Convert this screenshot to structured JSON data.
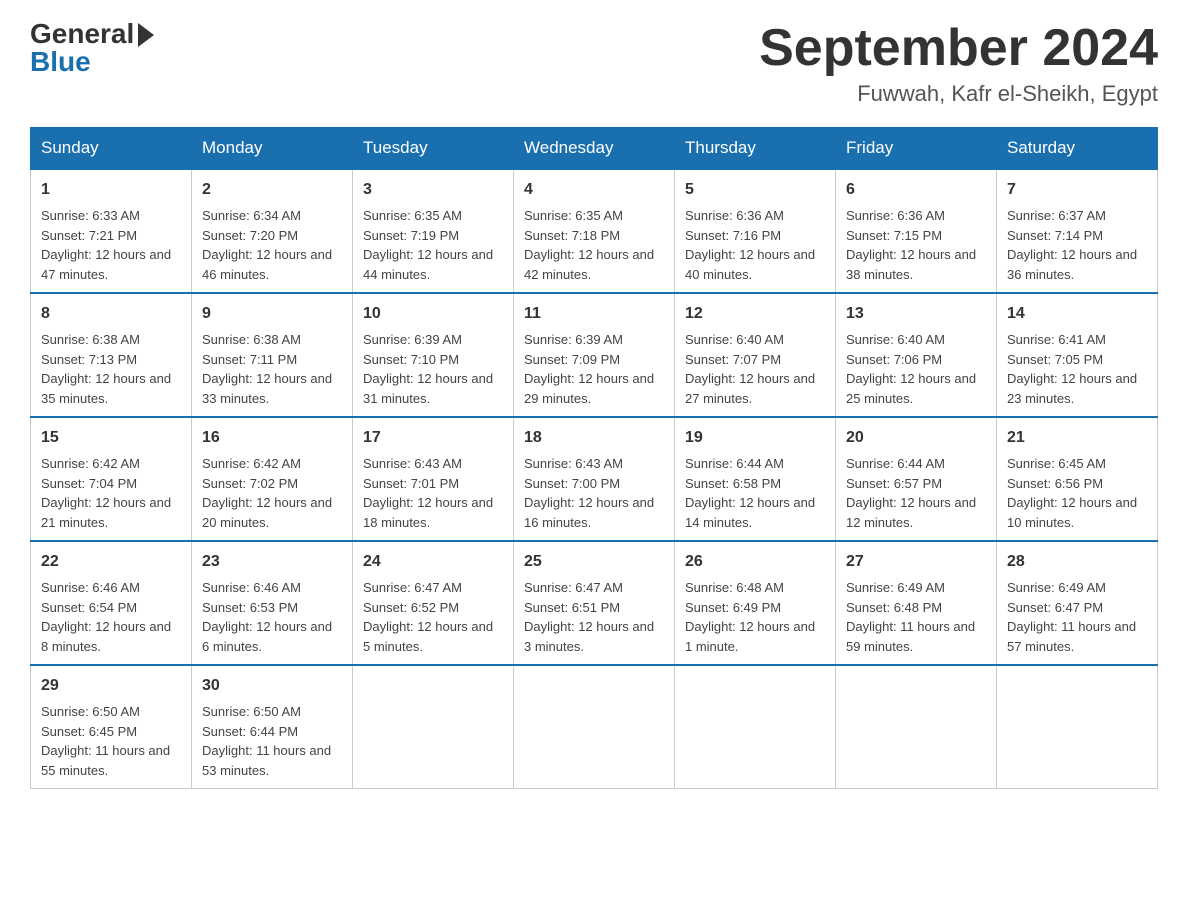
{
  "logo": {
    "general": "General",
    "blue": "Blue"
  },
  "title": "September 2024",
  "location": "Fuwwah, Kafr el-Sheikh, Egypt",
  "weekdays": [
    "Sunday",
    "Monday",
    "Tuesday",
    "Wednesday",
    "Thursday",
    "Friday",
    "Saturday"
  ],
  "weeks": [
    [
      {
        "day": "1",
        "sunrise": "6:33 AM",
        "sunset": "7:21 PM",
        "daylight": "12 hours and 47 minutes."
      },
      {
        "day": "2",
        "sunrise": "6:34 AM",
        "sunset": "7:20 PM",
        "daylight": "12 hours and 46 minutes."
      },
      {
        "day": "3",
        "sunrise": "6:35 AM",
        "sunset": "7:19 PM",
        "daylight": "12 hours and 44 minutes."
      },
      {
        "day": "4",
        "sunrise": "6:35 AM",
        "sunset": "7:18 PM",
        "daylight": "12 hours and 42 minutes."
      },
      {
        "day": "5",
        "sunrise": "6:36 AM",
        "sunset": "7:16 PM",
        "daylight": "12 hours and 40 minutes."
      },
      {
        "day": "6",
        "sunrise": "6:36 AM",
        "sunset": "7:15 PM",
        "daylight": "12 hours and 38 minutes."
      },
      {
        "day": "7",
        "sunrise": "6:37 AM",
        "sunset": "7:14 PM",
        "daylight": "12 hours and 36 minutes."
      }
    ],
    [
      {
        "day": "8",
        "sunrise": "6:38 AM",
        "sunset": "7:13 PM",
        "daylight": "12 hours and 35 minutes."
      },
      {
        "day": "9",
        "sunrise": "6:38 AM",
        "sunset": "7:11 PM",
        "daylight": "12 hours and 33 minutes."
      },
      {
        "day": "10",
        "sunrise": "6:39 AM",
        "sunset": "7:10 PM",
        "daylight": "12 hours and 31 minutes."
      },
      {
        "day": "11",
        "sunrise": "6:39 AM",
        "sunset": "7:09 PM",
        "daylight": "12 hours and 29 minutes."
      },
      {
        "day": "12",
        "sunrise": "6:40 AM",
        "sunset": "7:07 PM",
        "daylight": "12 hours and 27 minutes."
      },
      {
        "day": "13",
        "sunrise": "6:40 AM",
        "sunset": "7:06 PM",
        "daylight": "12 hours and 25 minutes."
      },
      {
        "day": "14",
        "sunrise": "6:41 AM",
        "sunset": "7:05 PM",
        "daylight": "12 hours and 23 minutes."
      }
    ],
    [
      {
        "day": "15",
        "sunrise": "6:42 AM",
        "sunset": "7:04 PM",
        "daylight": "12 hours and 21 minutes."
      },
      {
        "day": "16",
        "sunrise": "6:42 AM",
        "sunset": "7:02 PM",
        "daylight": "12 hours and 20 minutes."
      },
      {
        "day": "17",
        "sunrise": "6:43 AM",
        "sunset": "7:01 PM",
        "daylight": "12 hours and 18 minutes."
      },
      {
        "day": "18",
        "sunrise": "6:43 AM",
        "sunset": "7:00 PM",
        "daylight": "12 hours and 16 minutes."
      },
      {
        "day": "19",
        "sunrise": "6:44 AM",
        "sunset": "6:58 PM",
        "daylight": "12 hours and 14 minutes."
      },
      {
        "day": "20",
        "sunrise": "6:44 AM",
        "sunset": "6:57 PM",
        "daylight": "12 hours and 12 minutes."
      },
      {
        "day": "21",
        "sunrise": "6:45 AM",
        "sunset": "6:56 PM",
        "daylight": "12 hours and 10 minutes."
      }
    ],
    [
      {
        "day": "22",
        "sunrise": "6:46 AM",
        "sunset": "6:54 PM",
        "daylight": "12 hours and 8 minutes."
      },
      {
        "day": "23",
        "sunrise": "6:46 AM",
        "sunset": "6:53 PM",
        "daylight": "12 hours and 6 minutes."
      },
      {
        "day": "24",
        "sunrise": "6:47 AM",
        "sunset": "6:52 PM",
        "daylight": "12 hours and 5 minutes."
      },
      {
        "day": "25",
        "sunrise": "6:47 AM",
        "sunset": "6:51 PM",
        "daylight": "12 hours and 3 minutes."
      },
      {
        "day": "26",
        "sunrise": "6:48 AM",
        "sunset": "6:49 PM",
        "daylight": "12 hours and 1 minute."
      },
      {
        "day": "27",
        "sunrise": "6:49 AM",
        "sunset": "6:48 PM",
        "daylight": "11 hours and 59 minutes."
      },
      {
        "day": "28",
        "sunrise": "6:49 AM",
        "sunset": "6:47 PM",
        "daylight": "11 hours and 57 minutes."
      }
    ],
    [
      {
        "day": "29",
        "sunrise": "6:50 AM",
        "sunset": "6:45 PM",
        "daylight": "11 hours and 55 minutes."
      },
      {
        "day": "30",
        "sunrise": "6:50 AM",
        "sunset": "6:44 PM",
        "daylight": "11 hours and 53 minutes."
      },
      null,
      null,
      null,
      null,
      null
    ]
  ],
  "labels": {
    "sunrise": "Sunrise:",
    "sunset": "Sunset:",
    "daylight": "Daylight:"
  }
}
